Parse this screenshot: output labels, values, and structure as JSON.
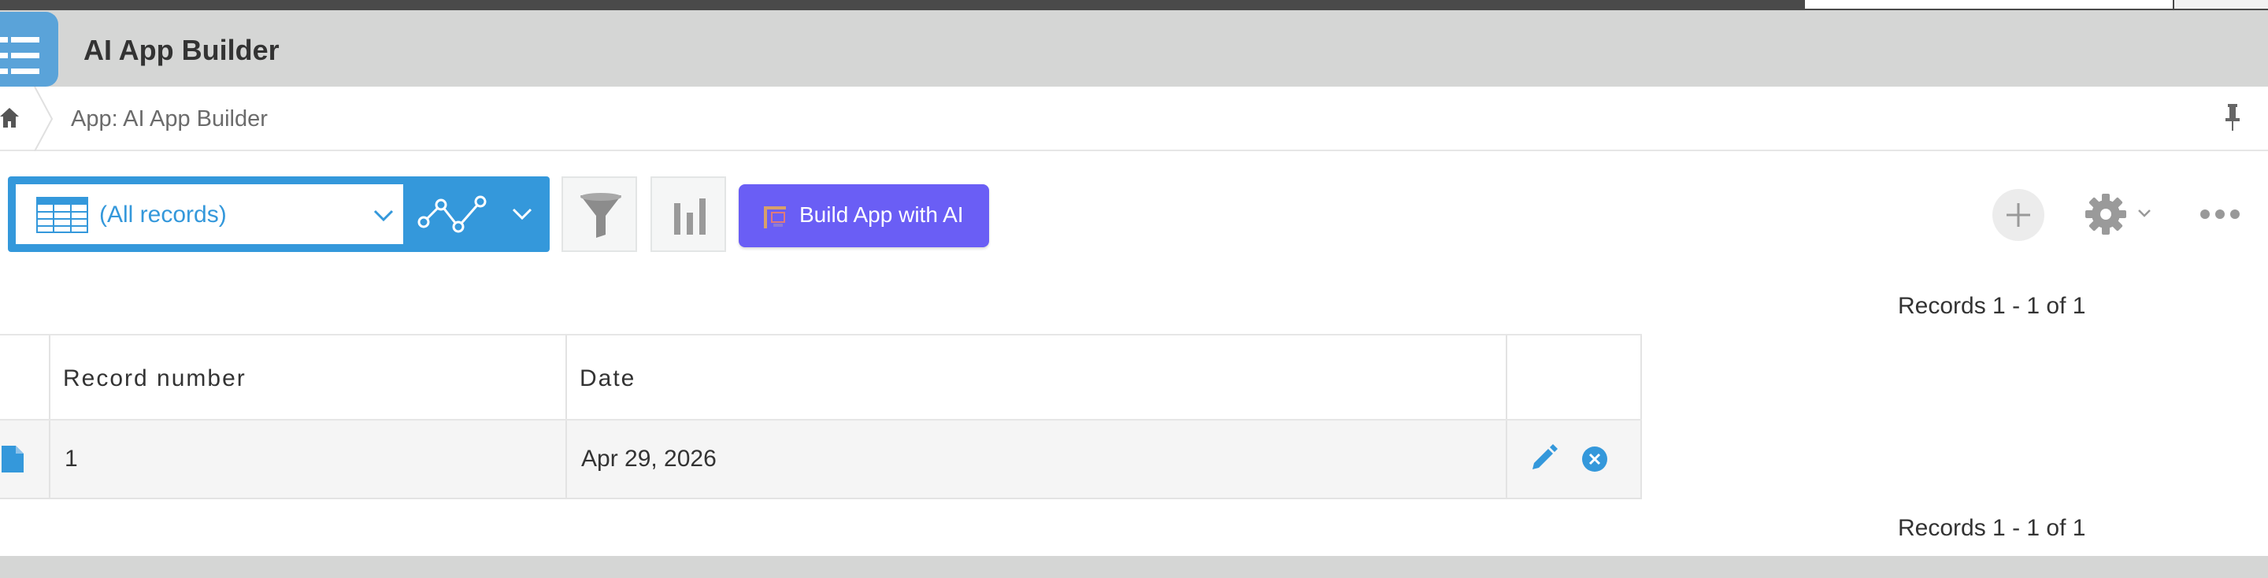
{
  "app": {
    "title": "AI App Builder"
  },
  "breadcrumb": {
    "text": "App: AI App Builder"
  },
  "toolbar": {
    "view_label": "(All records)",
    "build_ai_label": "Build App with AI"
  },
  "records": {
    "count_top": "Records 1 - 1 of 1",
    "count_bottom": "Records 1 - 1 of 1"
  },
  "table": {
    "headers": [
      "Record number",
      "Date"
    ],
    "rows": [
      {
        "record_number": "1",
        "date": "Apr 29, 2026"
      }
    ]
  },
  "colors": {
    "accent": "#3498db",
    "ai_button": "#6a5ef5",
    "header_gray": "#d5d6d5"
  },
  "icons": [
    "app-list-icon",
    "home-icon",
    "pin-icon",
    "table-grid-icon",
    "chevron-down-icon",
    "graph-icon",
    "filter-icon",
    "bar-chart-icon",
    "ai-builder-icon",
    "plus-icon",
    "gear-icon",
    "more-icon",
    "document-icon",
    "edit-pencil-icon",
    "delete-x-icon"
  ]
}
